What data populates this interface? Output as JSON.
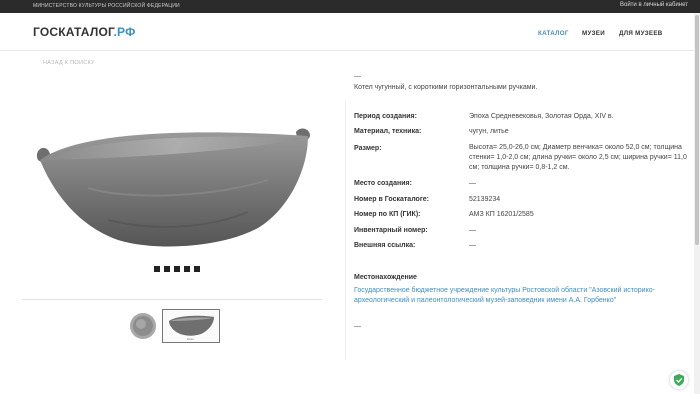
{
  "topbar": {
    "ministry": "МИНИСТЕРСТВО КУЛЬТУРЫ РОССИЙСКОЙ ФЕДЕРАЦИИ",
    "login": "Войти в личный кабинет"
  },
  "header": {
    "logo_main": "ГОСКАТАЛОГ",
    "logo_suffix": ".РФ",
    "nav": [
      "КАТАЛОГ",
      "МУЗЕИ",
      "ДЛЯ МУЗЕЕВ"
    ],
    "active_nav": "КАТАЛОГ"
  },
  "back_link": "НАЗАД К ПОИСКУ",
  "gallery": {
    "slide_count": 5,
    "thumb2_caption": "Котел"
  },
  "item": {
    "dash": "—",
    "description": "Котел чугунный, с короткими горизонтальными ручками.",
    "fields": [
      {
        "label": "Период создания:",
        "value": "Эпоха Средневековья, Золотая Орда, XIV в."
      },
      {
        "label": "Материал, техника:",
        "value": "чугун, литье"
      },
      {
        "label": "Размер:",
        "value": "Высота= 25,0-26,0 см; Диаметр венчика= около 52,0 см; толщина стенки= 1,0-2,0 см; длина ручки= около 2,5 см; ширина ручки= 11,0 см; толщина ручки= 0,8-1,2 см."
      },
      {
        "label": "Место создания:",
        "value": "—"
      },
      {
        "label": "Номер в Госкаталоге:",
        "value": "52139234"
      },
      {
        "label": "Номер по КП (ГИК):",
        "value": "АМЗ КП 16201/2585"
      },
      {
        "label": "Инвентарный номер:",
        "value": "—"
      },
      {
        "label": "Внешняя ссылка:",
        "value": "—"
      }
    ],
    "location_title": "Местонахождение",
    "location_link": "Государственное бюджетное учреждение культуры Ростовской области \"Азовский историко-археологический и палеонтологический музей-заповедник имени А.А. Горбенко\"",
    "bottom_dash": "—"
  },
  "colors": {
    "accent": "#3d8ec2",
    "topbar": "#2b2b2b",
    "cauldron": "#7a7a7a"
  }
}
